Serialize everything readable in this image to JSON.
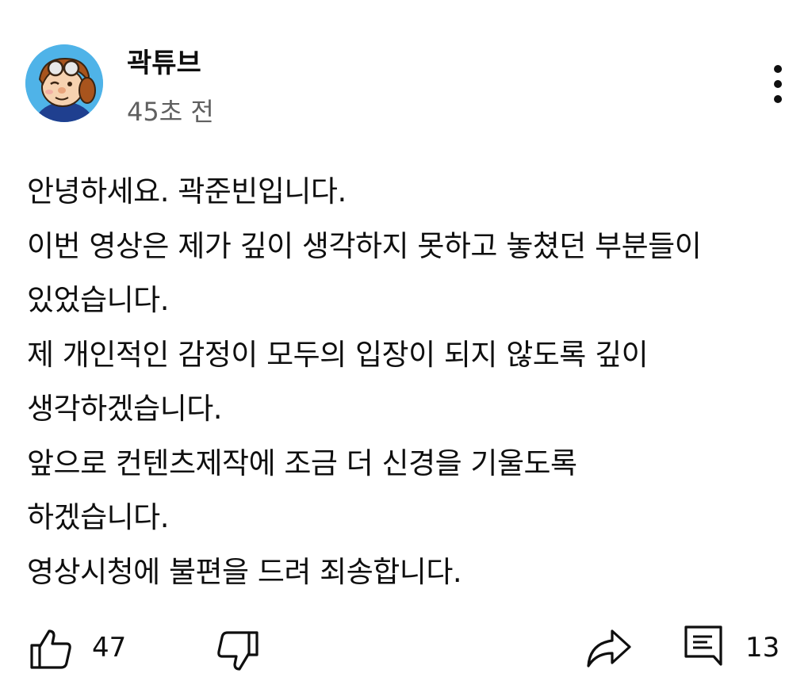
{
  "post": {
    "channel_name": "곽튜브",
    "timestamp": "45초 전",
    "avatar_icon": "cartoon-character-avatar",
    "more_icon": "more-vertical-icon"
  },
  "body_lines": [
    "안녕하세요. 곽준빈입니다.",
    "이번 영상은 제가 깊이 생각하지 못하고 놓쳤던 부분들이",
    "있었습니다.",
    "제 개인적인 감정이 모두의 입장이 되지 않도록 깊이",
    "생각하겠습니다.",
    "앞으로 컨텐츠제작에 조금 더 신경을 기울도록",
    "하겠습니다.",
    "영상시청에 불편을 드려 죄송합니다."
  ],
  "actions": {
    "like_count": "47",
    "comment_count": "13",
    "like_icon": "thumbs-up-icon",
    "dislike_icon": "thumbs-down-icon",
    "share_icon": "share-icon",
    "comment_icon": "comment-icon"
  }
}
